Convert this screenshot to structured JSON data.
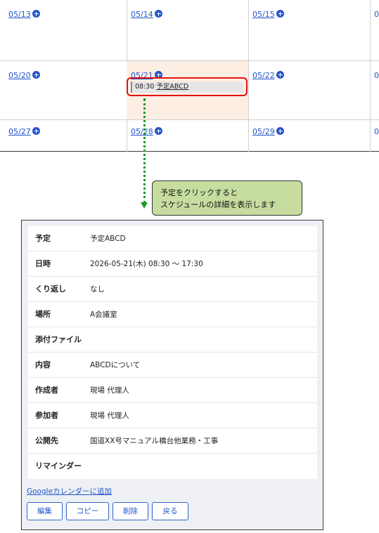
{
  "calendar": {
    "rows": [
      {
        "dates": [
          "05/13",
          "05/14",
          "05/15"
        ]
      },
      {
        "dates": [
          "05/20",
          "05/21",
          "05/22"
        ]
      },
      {
        "dates": [
          "05/27",
          "05/28",
          "05/29"
        ]
      }
    ],
    "edge_mark": "0",
    "event": {
      "time": "08:30",
      "title": "予定ABCD"
    }
  },
  "callout": {
    "line1": "予定をクリックすると",
    "line2": "スケジュールの詳細を表示します"
  },
  "detail": {
    "rows": [
      {
        "label": "予定",
        "value": "予定ABCD"
      },
      {
        "label": "日時",
        "value": "2026-05-21(木) 08:30 ～ 17:30"
      },
      {
        "label": "くり返し",
        "value": "なし"
      },
      {
        "label": "場所",
        "value": "A会議室"
      },
      {
        "label": "添付ファイル",
        "value": ""
      },
      {
        "label": "内容",
        "value": "ABCDについて"
      },
      {
        "label": "作成者",
        "value": "現場 代理人"
      },
      {
        "label": "参加者",
        "value": "現場 代理人"
      },
      {
        "label": "公開先",
        "value": "国道XX号マニュアル橋台他業務・工事"
      },
      {
        "label": "リマインダー",
        "value": ""
      }
    ],
    "google_link": "Googleカレンダーに追加",
    "buttons": {
      "edit": "編集",
      "copy": "コピー",
      "delete": "削除",
      "back": "戻る"
    }
  },
  "colors": {
    "link": "#2255cc",
    "highlight_cell": "#fdeee4",
    "red_outline": "#e31212",
    "green_arrow": "#1a9a2a",
    "callout_bg": "#c6dd9f"
  }
}
